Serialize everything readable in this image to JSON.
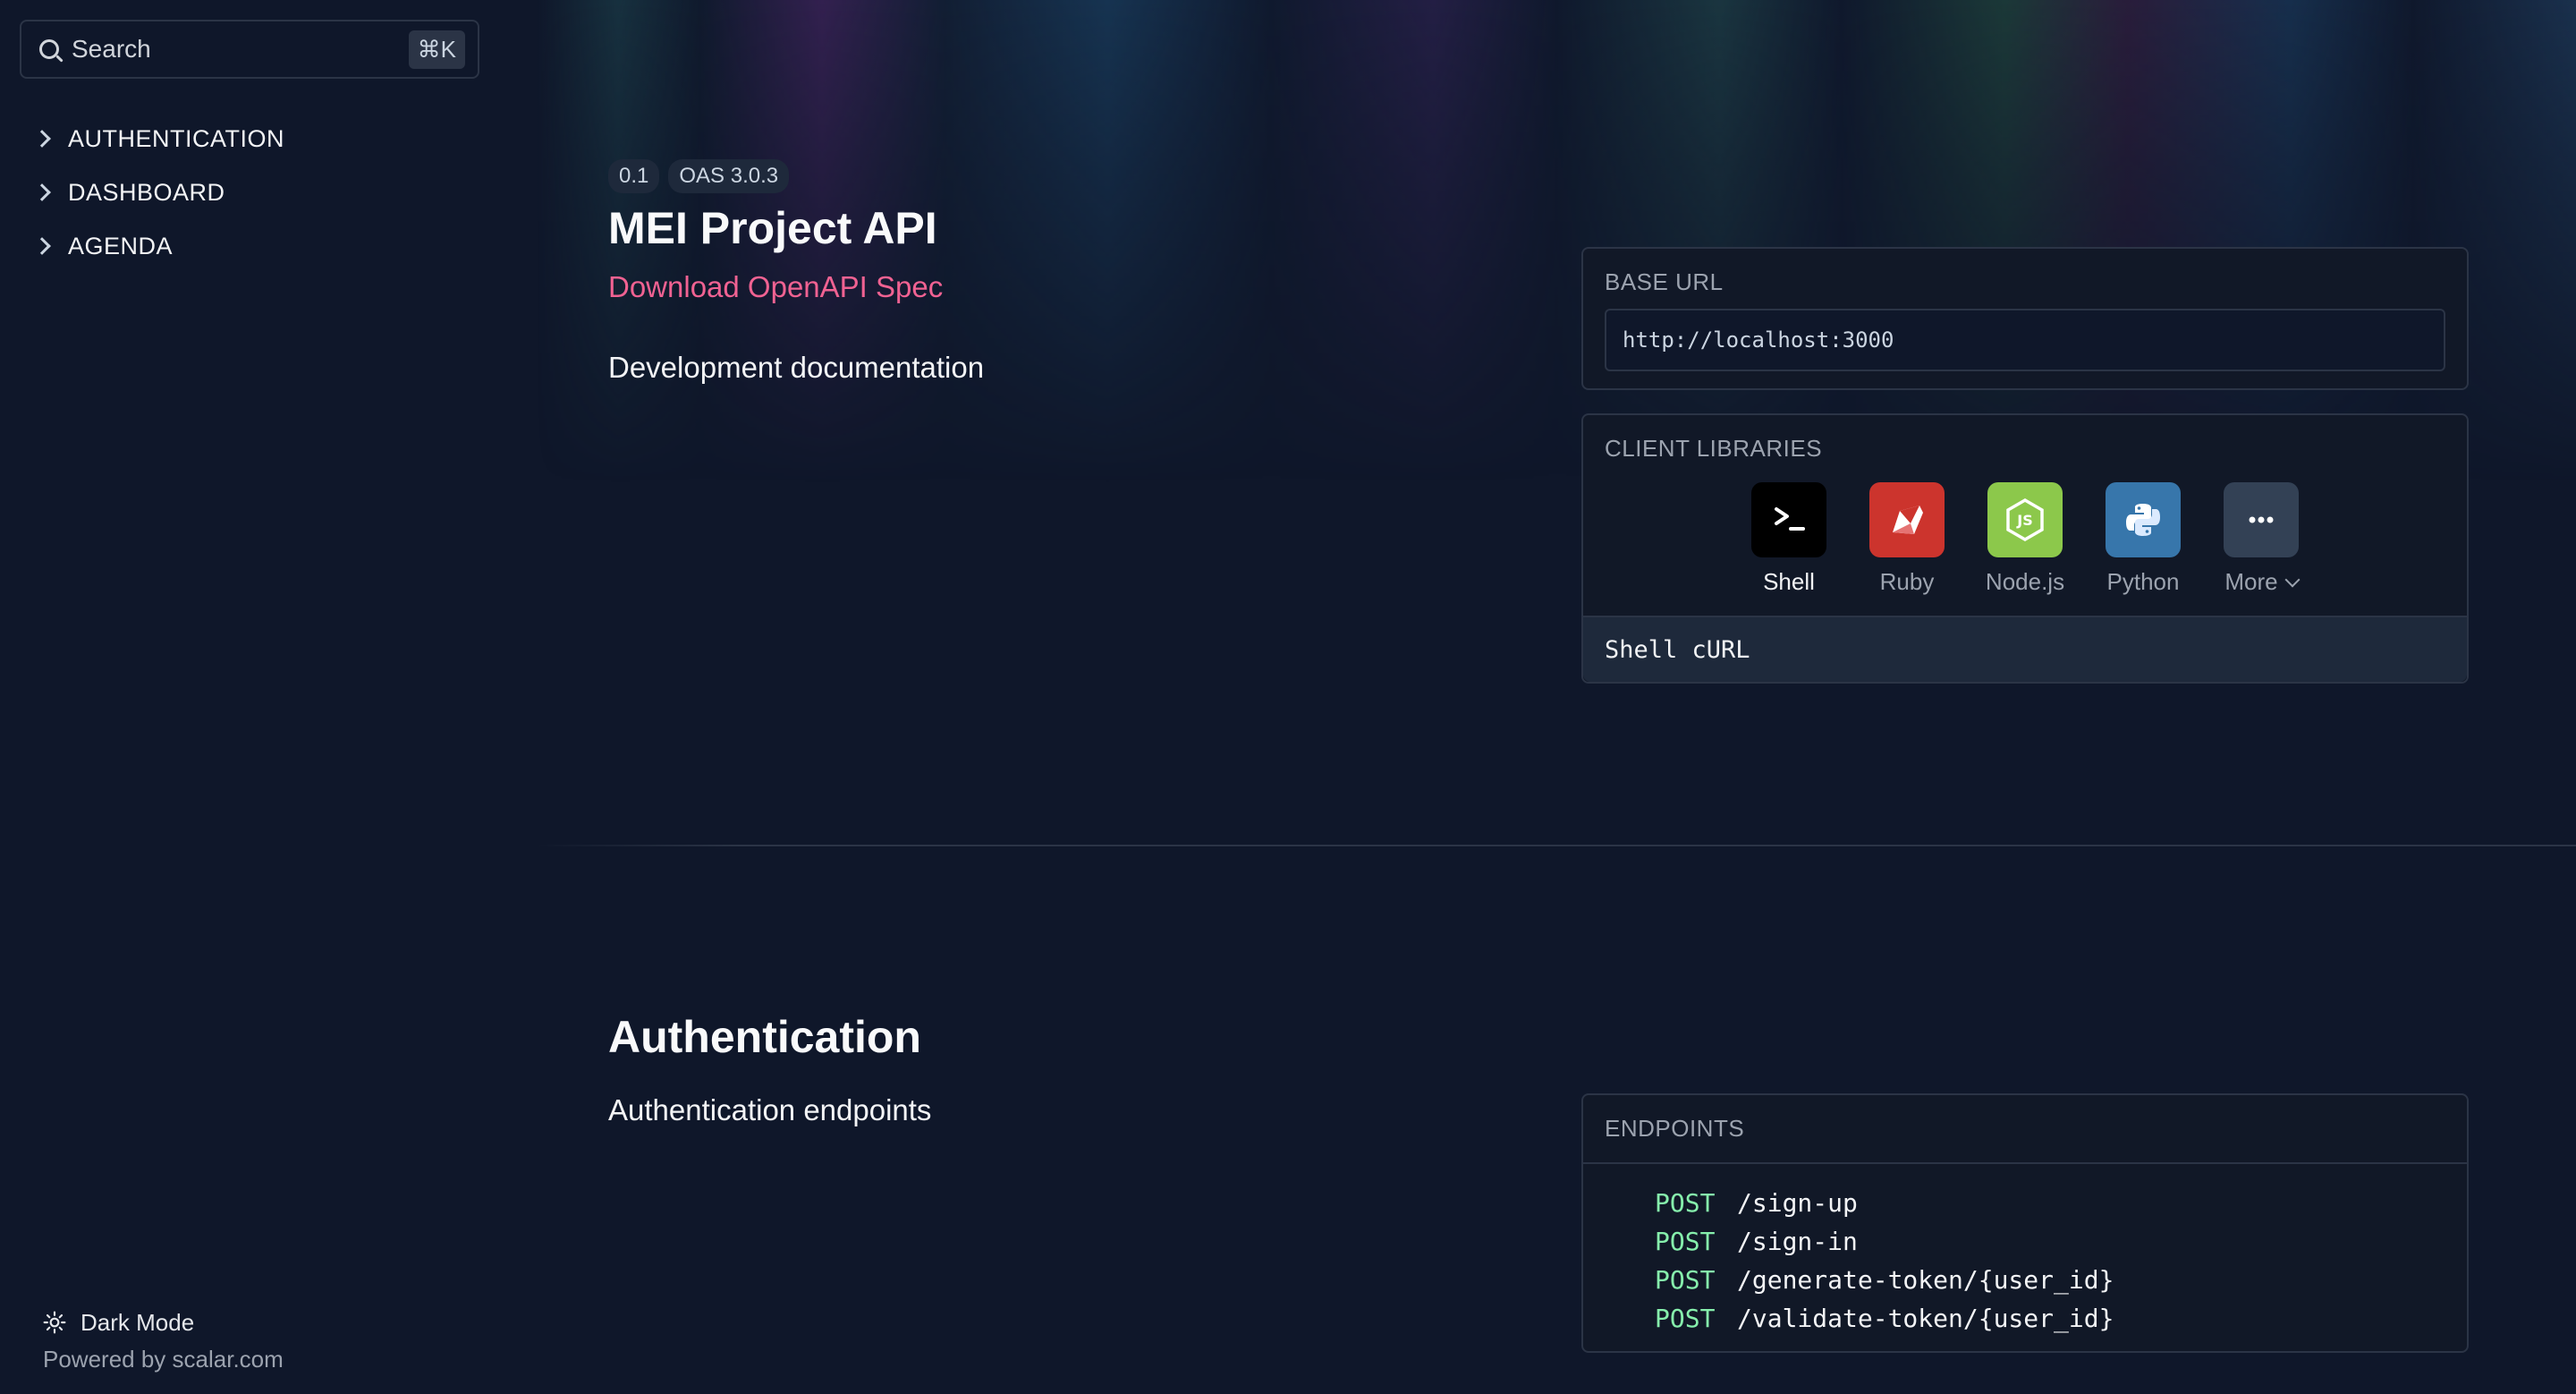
{
  "search": {
    "placeholder": "Search",
    "shortcut": "⌘K"
  },
  "sidebar": {
    "items": [
      {
        "label": "AUTHENTICATION"
      },
      {
        "label": "DASHBOARD"
      },
      {
        "label": "AGENDA"
      }
    ],
    "dark_mode_label": "Dark Mode",
    "powered_by": "Powered by scalar.com"
  },
  "header": {
    "version_badge": "0.1",
    "oas_badge": "OAS 3.0.3",
    "title": "MEI Project API",
    "download_link": "Download OpenAPI Spec",
    "description": "Development documentation"
  },
  "base_url": {
    "label": "BASE URL",
    "value": "http://localhost:3000"
  },
  "client_libraries": {
    "label": "CLIENT LIBRARIES",
    "items": [
      {
        "name": "Shell",
        "icon": "terminal-icon",
        "color": "#000000",
        "active": true
      },
      {
        "name": "Ruby",
        "icon": "ruby-icon",
        "color": "#cc342d",
        "active": false
      },
      {
        "name": "Node.js",
        "icon": "nodejs-icon",
        "color": "#8cc84b",
        "active": false
      },
      {
        "name": "Python",
        "icon": "python-icon",
        "color": "#3776ab",
        "active": false
      },
      {
        "name": "More",
        "icon": "more-icon",
        "color": "#334155",
        "active": false
      }
    ],
    "selected": "Shell cURL"
  },
  "authentication": {
    "title": "Authentication",
    "description": "Authentication endpoints",
    "endpoints_label": "ENDPOINTS",
    "endpoints": [
      {
        "method": "POST",
        "path": "/sign-up"
      },
      {
        "method": "POST",
        "path": "/sign-in"
      },
      {
        "method": "POST",
        "path": "/generate-token/{user_id}"
      },
      {
        "method": "POST",
        "path": "/validate-token/{user_id}"
      }
    ]
  },
  "colors": {
    "accent_link": "#f06292",
    "method_post": "#86efac",
    "background": "#0f172a"
  }
}
